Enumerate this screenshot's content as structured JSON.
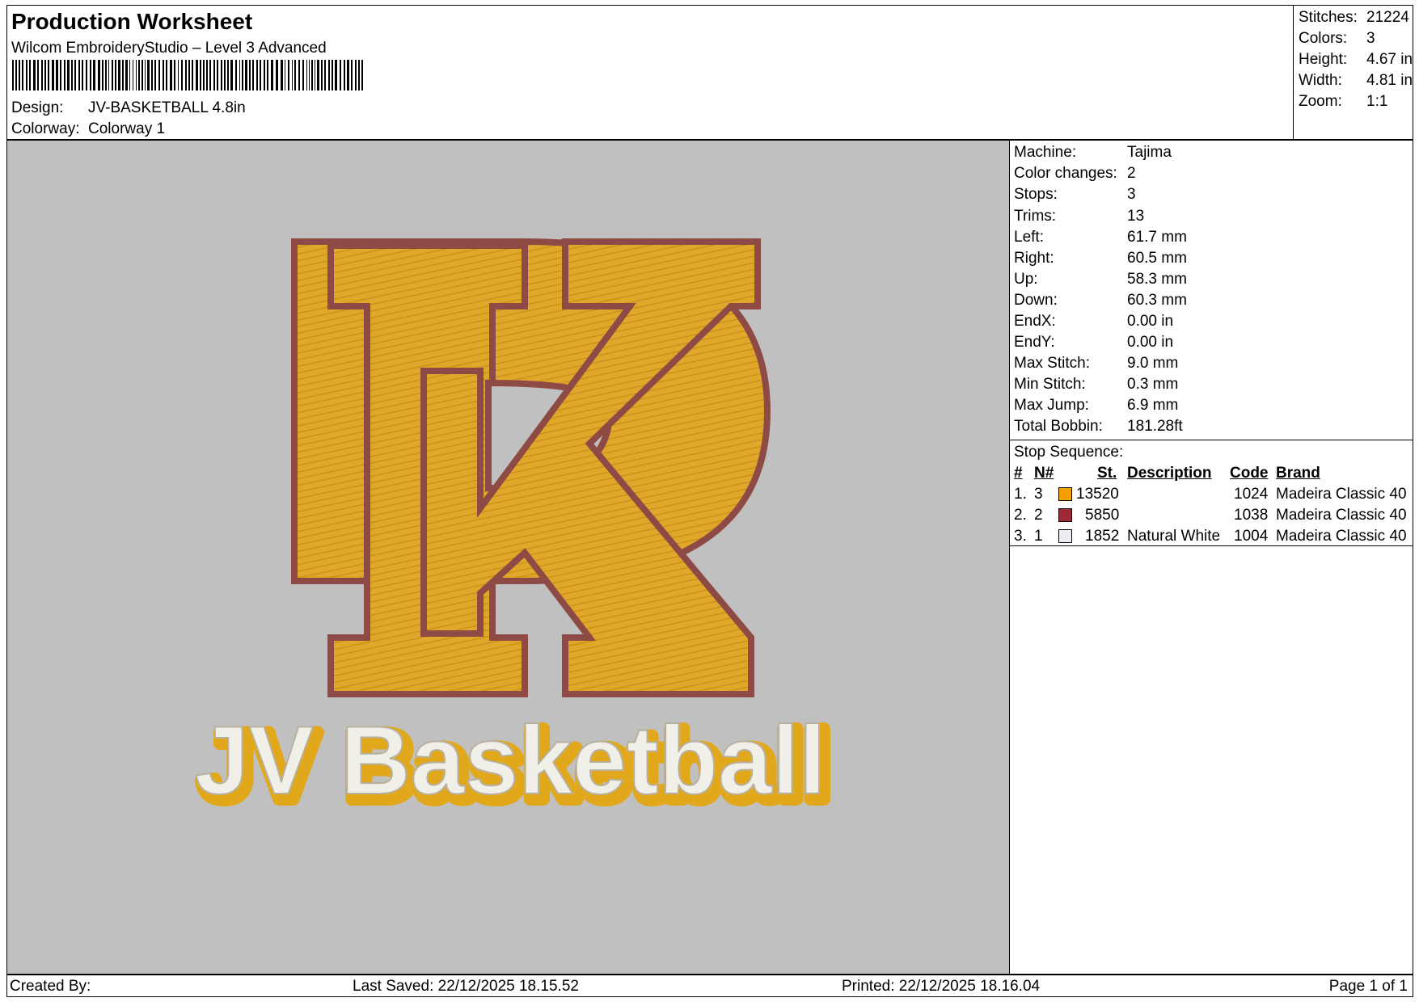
{
  "header": {
    "title": "Production Worksheet",
    "subtitle": "Wilcom EmbroideryStudio – Level 3 Advanced",
    "design_label": "Design:",
    "design_value": "JV-BASKETBALL 4.8in",
    "colorway_label": "Colorway:",
    "colorway_value": "Colorway 1"
  },
  "stats": [
    {
      "label": "Stitches:",
      "value": "21224"
    },
    {
      "label": "Colors:",
      "value": "3"
    },
    {
      "label": "Height:",
      "value": "4.67 in"
    },
    {
      "label": "Width:",
      "value": "4.81 in"
    },
    {
      "label": "Zoom:",
      "value": "1:1"
    }
  ],
  "machine": [
    {
      "label": "Machine:",
      "value": "Tajima"
    },
    {
      "label": "Color changes:",
      "value": "2"
    },
    {
      "label": "Stops:",
      "value": "3"
    },
    {
      "label": "Trims:",
      "value": "13"
    },
    {
      "label": "Left:",
      "value": "61.7 mm"
    },
    {
      "label": "Right:",
      "value": "60.5 mm"
    },
    {
      "label": "Up:",
      "value": "58.3 mm"
    },
    {
      "label": "Down:",
      "value": "60.3 mm"
    },
    {
      "label": "EndX:",
      "value": "0.00 in"
    },
    {
      "label": "EndY:",
      "value": "0.00 in"
    },
    {
      "label": "Max Stitch:",
      "value": "9.0 mm"
    },
    {
      "label": "Min Stitch:",
      "value": "0.3 mm"
    },
    {
      "label": "Max Jump:",
      "value": "6.9 mm"
    },
    {
      "label": "Total Bobbin:",
      "value": "181.28ft"
    }
  ],
  "stop_sequence": {
    "heading": "Stop Sequence:",
    "columns": [
      "#",
      "N#",
      "St.",
      "Description",
      "Code",
      "Brand"
    ],
    "rows": [
      {
        "num": "1.",
        "n": "3",
        "color": "#f5a000",
        "st": "13520",
        "desc": "",
        "code": "1024",
        "brand": "Madeira Classic 40"
      },
      {
        "num": "2.",
        "n": "2",
        "color": "#9c2b35",
        "st": "5850",
        "desc": "",
        "code": "1038",
        "brand": "Madeira Classic 40"
      },
      {
        "num": "3.",
        "n": "1",
        "color": "#ececf2",
        "st": "1852",
        "desc": "Natural White",
        "code": "1004",
        "brand": "Madeira Classic 40"
      }
    ]
  },
  "design_preview": {
    "text": "JV Basketball",
    "colors": {
      "fill": "#e0a72a",
      "outline": "#8e4b45",
      "text": "#f0efe8",
      "text_edge": "#e2a81c"
    }
  },
  "footer": {
    "created_by": "Created By:",
    "last_saved": "Last Saved: 22/12/2025 18.15.52",
    "printed": "Printed: 22/12/2025 18.16.04",
    "page": "Page 1 of 1"
  }
}
